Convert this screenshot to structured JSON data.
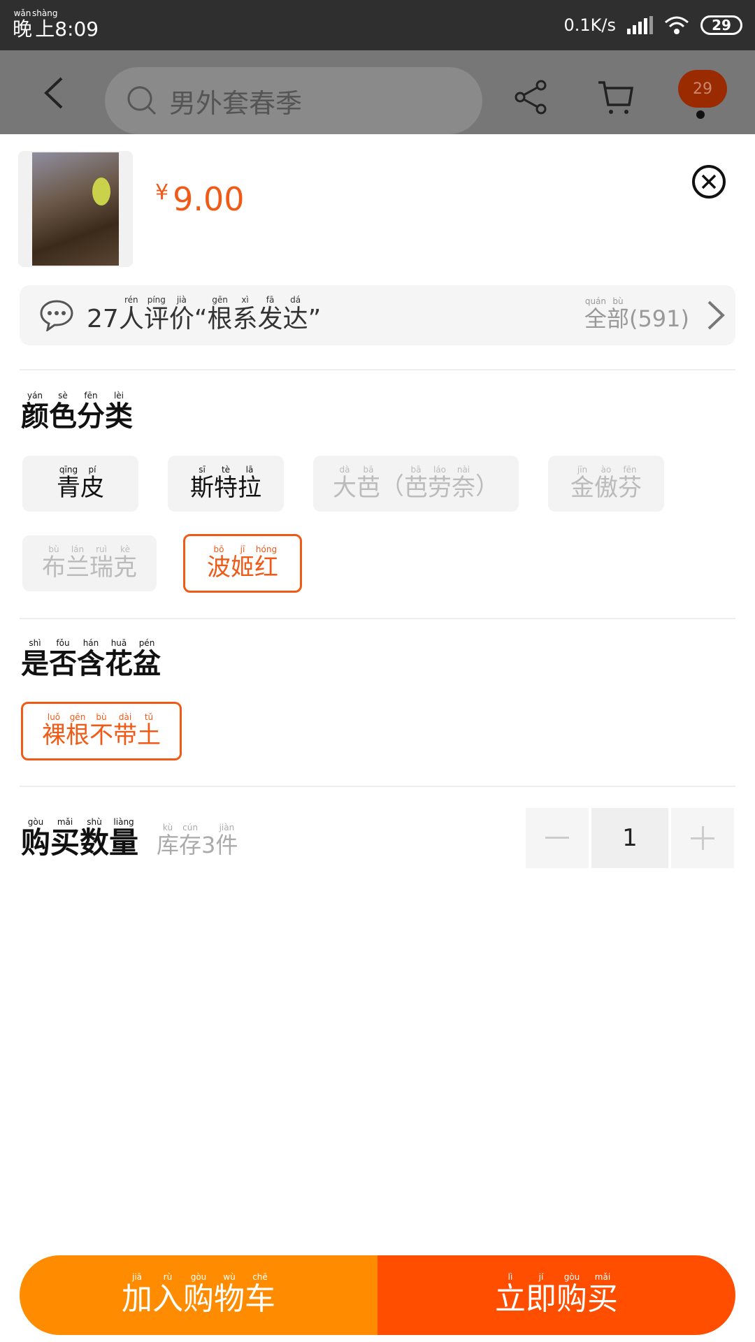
{
  "status": {
    "time_ruby": [
      {
        "c": "晚",
        "p": "wǎn"
      },
      {
        "c": "上",
        "p": "shàng"
      }
    ],
    "time": "8:09",
    "speed": "0.1K/s",
    "battery": "29"
  },
  "header": {
    "search_placeholder": "男外套春季",
    "badge": "29"
  },
  "product": {
    "currency": "¥",
    "price": "9.00"
  },
  "review": {
    "count": "27",
    "text_ruby": [
      {
        "c": "人",
        "p": "rén"
      },
      {
        "c": "评",
        "p": "píng"
      },
      {
        "c": "价",
        "p": "jià"
      },
      {
        "c": "“",
        "p": ""
      },
      {
        "c": "根",
        "p": "gēn"
      },
      {
        "c": "系",
        "p": "xì"
      },
      {
        "c": "发",
        "p": "fā"
      },
      {
        "c": "达",
        "p": "dá"
      },
      {
        "c": "”",
        "p": ""
      }
    ],
    "all_ruby": [
      {
        "c": "全",
        "p": "quán"
      },
      {
        "c": "部",
        "p": "bù"
      }
    ],
    "all_count": "(591)"
  },
  "color_section": {
    "title_ruby": [
      {
        "c": "颜",
        "p": "yán"
      },
      {
        "c": "色",
        "p": "sè"
      },
      {
        "c": "分",
        "p": "fēn"
      },
      {
        "c": "类",
        "p": "lèi"
      }
    ],
    "options": [
      {
        "ruby": [
          {
            "c": "青",
            "p": "qīng"
          },
          {
            "c": "皮",
            "p": "pí"
          }
        ],
        "state": "normal"
      },
      {
        "ruby": [
          {
            "c": "斯",
            "p": "sī"
          },
          {
            "c": "特",
            "p": "tè"
          },
          {
            "c": "拉",
            "p": "lā"
          }
        ],
        "state": "normal"
      },
      {
        "ruby": [
          {
            "c": "大",
            "p": "dà"
          },
          {
            "c": "芭",
            "p": "bā"
          },
          {
            "c": "（",
            "p": ""
          },
          {
            "c": "芭",
            "p": "bā"
          },
          {
            "c": "劳",
            "p": "láo"
          },
          {
            "c": "奈",
            "p": "nài"
          },
          {
            "c": "）",
            "p": ""
          }
        ],
        "state": "disabled"
      },
      {
        "ruby": [
          {
            "c": "金",
            "p": "jīn"
          },
          {
            "c": "傲",
            "p": "ào"
          },
          {
            "c": "芬",
            "p": "fēn"
          }
        ],
        "state": "disabled"
      },
      {
        "ruby": [
          {
            "c": "布",
            "p": "bù"
          },
          {
            "c": "兰",
            "p": "lán"
          },
          {
            "c": "瑞",
            "p": "ruì"
          },
          {
            "c": "克",
            "p": "kè"
          }
        ],
        "state": "disabled"
      },
      {
        "ruby": [
          {
            "c": "波",
            "p": "bō"
          },
          {
            "c": "姬",
            "p": "jī"
          },
          {
            "c": "红",
            "p": "hóng"
          }
        ],
        "state": "selected"
      }
    ]
  },
  "pot_section": {
    "title_ruby": [
      {
        "c": "是",
        "p": "shì"
      },
      {
        "c": "否",
        "p": "fǒu"
      },
      {
        "c": "含",
        "p": "hán"
      },
      {
        "c": "花",
        "p": "huā"
      },
      {
        "c": "盆",
        "p": "pén"
      }
    ],
    "options": [
      {
        "ruby": [
          {
            "c": "裸",
            "p": "luǒ"
          },
          {
            "c": "根",
            "p": "gēn"
          },
          {
            "c": "不",
            "p": "bù"
          },
          {
            "c": "带",
            "p": "dài"
          },
          {
            "c": "土",
            "p": "tǔ"
          }
        ],
        "state": "selected"
      }
    ]
  },
  "quantity": {
    "label_ruby": [
      {
        "c": "购",
        "p": "gòu"
      },
      {
        "c": "买",
        "p": "mǎi"
      },
      {
        "c": "数",
        "p": "shù"
      },
      {
        "c": "量",
        "p": "liàng"
      }
    ],
    "stock_ruby": [
      {
        "c": "库",
        "p": "kù"
      },
      {
        "c": "存",
        "p": "cún"
      },
      {
        "c": "3",
        "p": ""
      },
      {
        "c": "件",
        "p": "jiàn"
      }
    ],
    "value": "1"
  },
  "actions": {
    "cart_ruby": [
      {
        "c": "加",
        "p": "jiā"
      },
      {
        "c": "入",
        "p": "rù"
      },
      {
        "c": "购",
        "p": "gòu"
      },
      {
        "c": "物",
        "p": "wù"
      },
      {
        "c": "车",
        "p": "chē"
      }
    ],
    "buy_ruby": [
      {
        "c": "立",
        "p": "lì"
      },
      {
        "c": "即",
        "p": "jí"
      },
      {
        "c": "购",
        "p": "gòu"
      },
      {
        "c": "买",
        "p": "mǎi"
      }
    ]
  },
  "colors": {
    "accent": "#f05a16",
    "cart_button": "#ff8c00",
    "buy_button": "#ff4e00",
    "disabled_text": "#bbbbbb"
  },
  "icons": [
    "back-icon",
    "search-icon",
    "share-icon",
    "cart-icon",
    "close-icon",
    "comment-icon",
    "chevron-right-icon",
    "minus-icon",
    "plus-icon"
  ]
}
